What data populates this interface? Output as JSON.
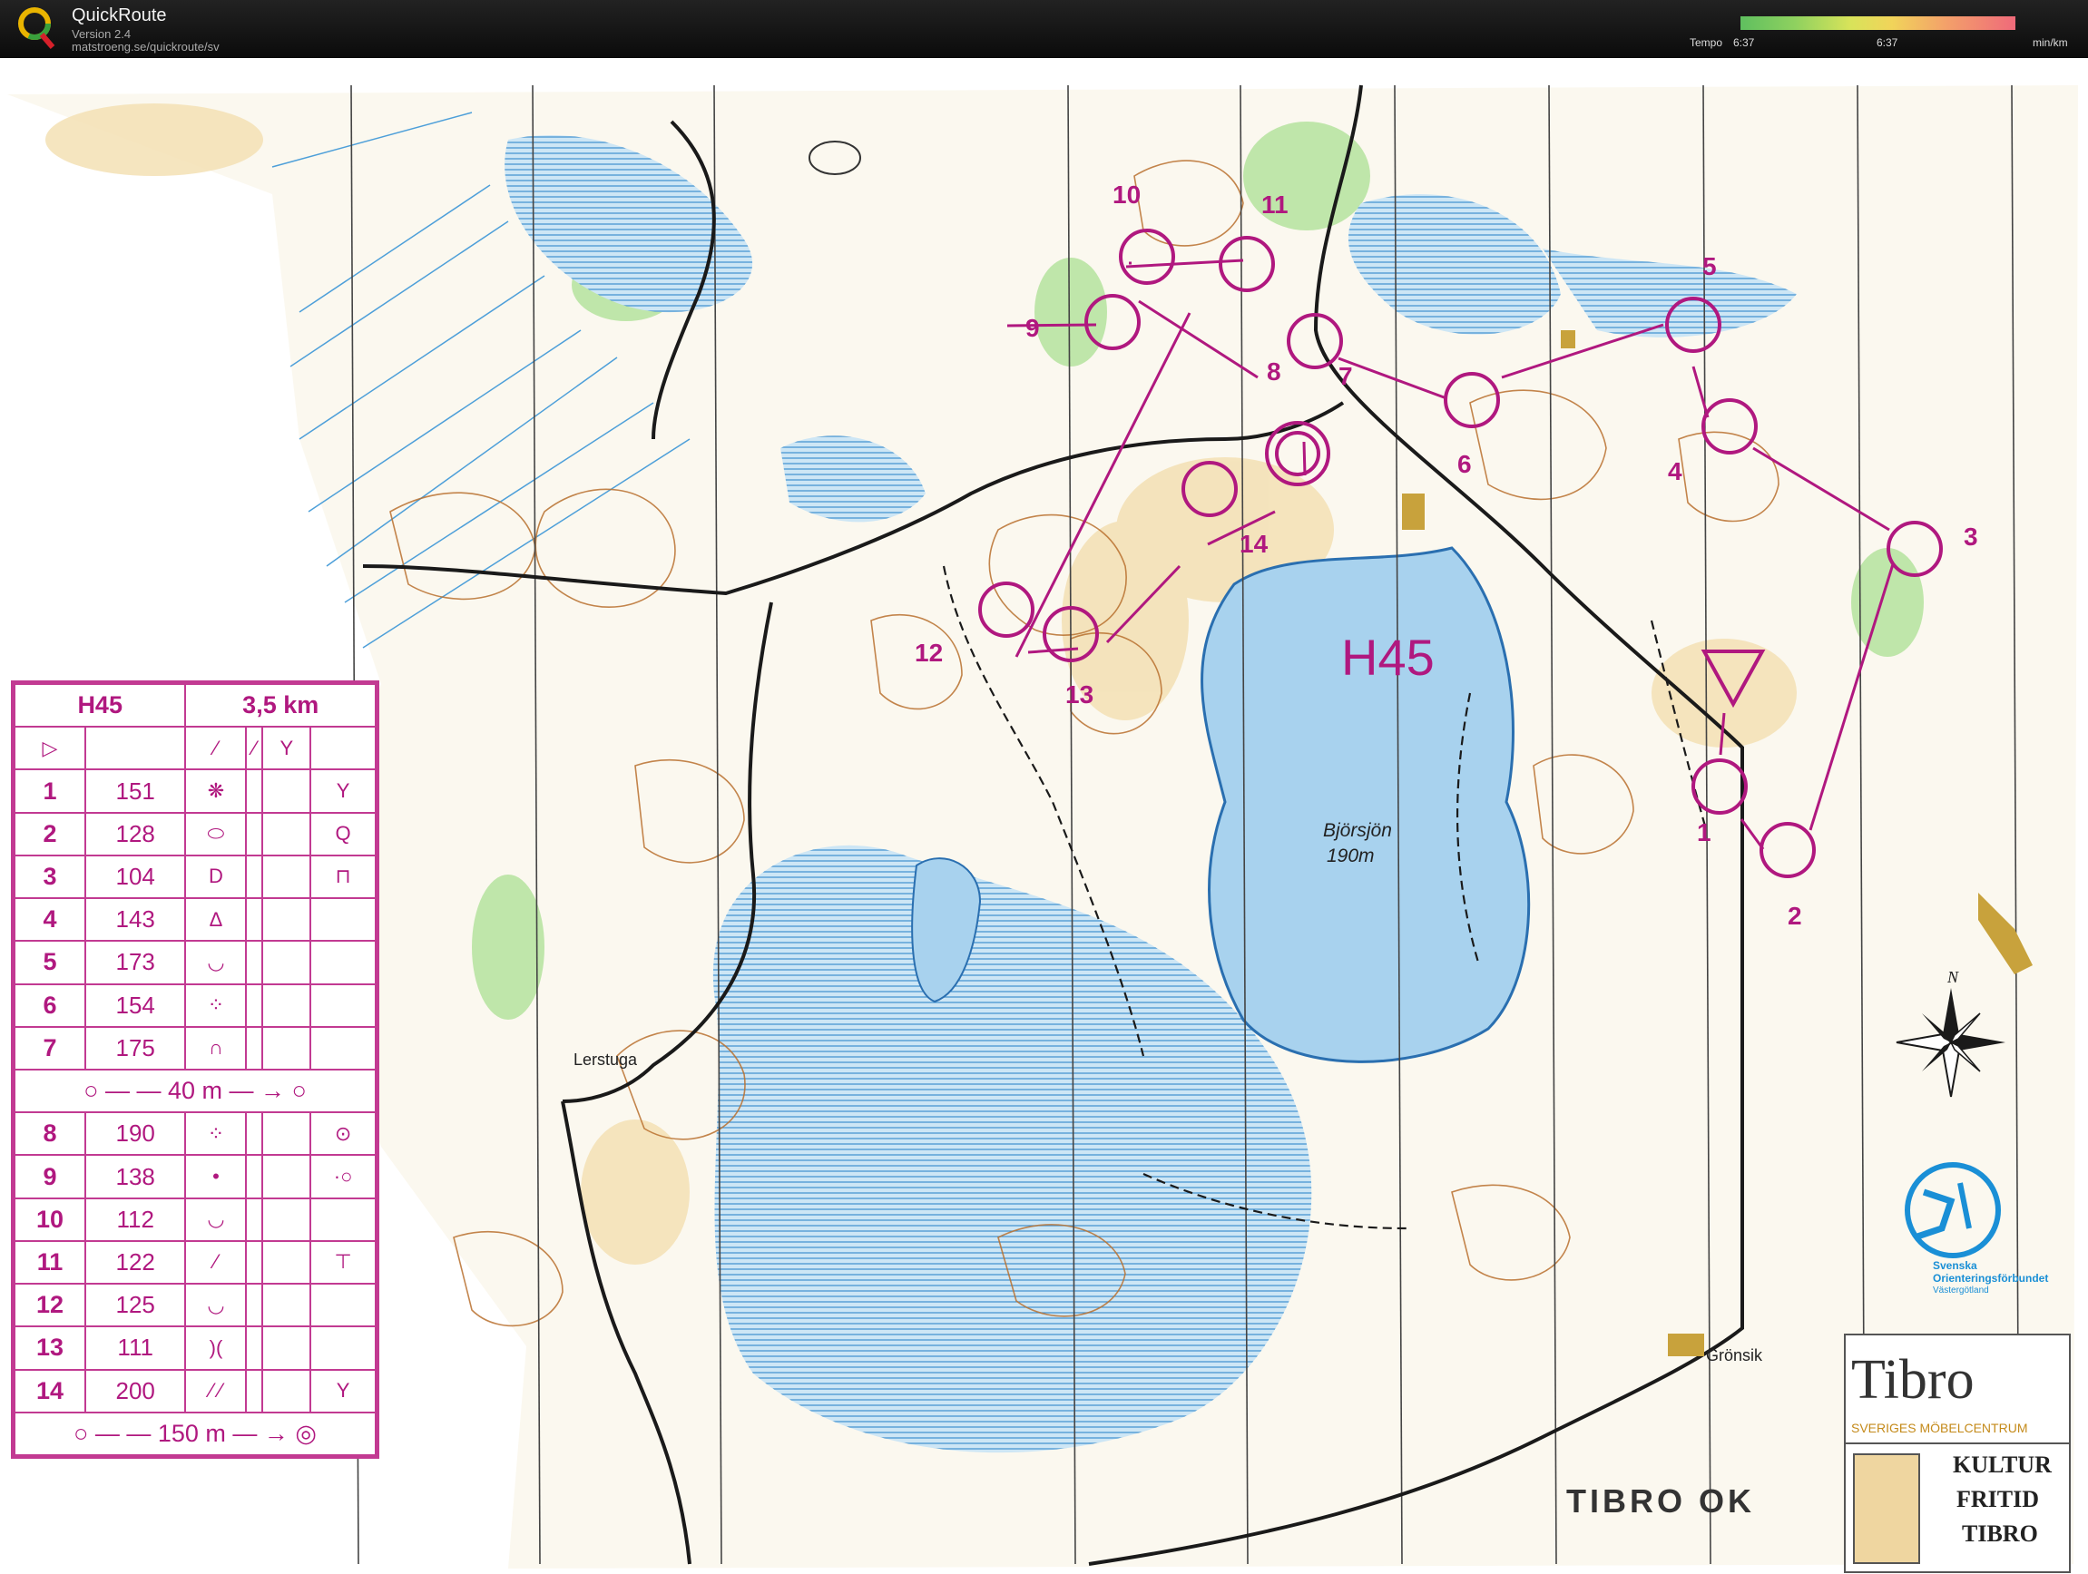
{
  "app": {
    "title": "QuickRoute",
    "version": "Version 2.4",
    "url": "matstroeng.se/quickroute/sv"
  },
  "tempo": {
    "label": "Tempo",
    "min": "6:37",
    "mid": "6:37",
    "unit": "min/km"
  },
  "map": {
    "course_name": "H45",
    "lake_name": "Björsjön",
    "lake_elevation": "190m",
    "places": [
      "Lerstuga",
      "Grönsik"
    ],
    "controls": [
      "1",
      "2",
      "3",
      "4",
      "5",
      "6",
      "7",
      "8",
      "9",
      "10",
      "11",
      "12",
      "13",
      "14"
    ]
  },
  "description": {
    "class": "H45",
    "length": "3,5 km",
    "rows": [
      {
        "num": "1",
        "code": "151",
        "sym": "❋",
        "extra": "Y"
      },
      {
        "num": "2",
        "code": "128",
        "sym": "⬭",
        "extra": "Q"
      },
      {
        "num": "3",
        "code": "104",
        "sym": "D",
        "extra": "⊓"
      },
      {
        "num": "4",
        "code": "143",
        "sym": "Δ",
        "extra": ""
      },
      {
        "num": "5",
        "code": "173",
        "sym": "◡",
        "extra": ""
      },
      {
        "num": "6",
        "code": "154",
        "sym": "⁘",
        "extra": ""
      },
      {
        "num": "7",
        "code": "175",
        "sym": "∩",
        "extra": ""
      }
    ],
    "leg1": "40 m",
    "rows2": [
      {
        "num": "8",
        "code": "190",
        "sym": "⁘",
        "extra": "⊙"
      },
      {
        "num": "9",
        "code": "138",
        "sym": "•",
        "extra": "·○"
      },
      {
        "num": "10",
        "code": "112",
        "sym": "◡",
        "extra": ""
      },
      {
        "num": "11",
        "code": "122",
        "sym": "⁄",
        "extra": "⊤"
      },
      {
        "num": "12",
        "code": "125",
        "sym": "◡",
        "extra": ""
      },
      {
        "num": "13",
        "code": "111",
        "sym": ")(",
        "extra": ""
      },
      {
        "num": "14",
        "code": "200",
        "sym": "⁄ ⁄",
        "extra": "Y"
      }
    ],
    "leg2": "150 m"
  },
  "sponsors": {
    "club": "TIBRO OK",
    "tibro": "Tibro",
    "tibro_sub": "SVERIGES MÖBELCENTRUM",
    "kultur1": "KULTUR",
    "kultur2": "FRITID",
    "kultur3": "TIBRO",
    "sof1": "Svenska",
    "sof2": "Orienteringsförbundet",
    "sof3": "Västergötland"
  },
  "colors": {
    "course": "#b0187f",
    "water": "#a8d2ee",
    "marsh": "#3d8fd0",
    "contour": "#b8702e",
    "vegetation": "#a6db8a",
    "open": "#f3d9a4"
  }
}
